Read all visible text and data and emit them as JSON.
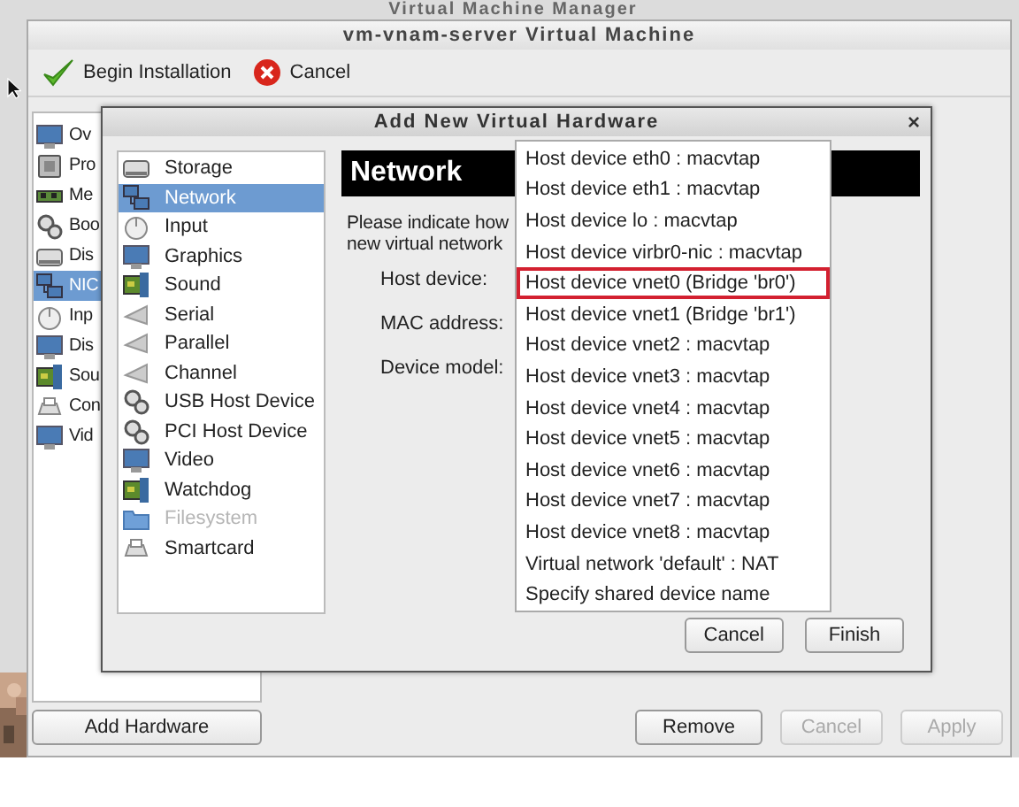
{
  "background_window": {
    "title": "Virtual Machine Manager"
  },
  "window": {
    "title": "vm-vnam-server Virtual Machine"
  },
  "toolbar": [
    {
      "label": "Begin Installation"
    },
    {
      "label": "Cancel"
    }
  ],
  "hardware_list": [
    {
      "label": "Ov",
      "selected": false
    },
    {
      "label": "Pro",
      "selected": false
    },
    {
      "label": "Me",
      "selected": false
    },
    {
      "label": "Boo",
      "selected": false
    },
    {
      "label": "Dis",
      "selected": false
    },
    {
      "label": "NIC",
      "selected": true
    },
    {
      "label": "Inp",
      "selected": false
    },
    {
      "label": "Dis",
      "selected": false
    },
    {
      "label": "Sou",
      "selected": false
    },
    {
      "label": "Con",
      "selected": false
    },
    {
      "label": "Vid",
      "selected": false
    }
  ],
  "add_hardware_button": "Add Hardware",
  "footer_buttons": [
    {
      "label": "Remove",
      "disabled": false
    },
    {
      "label": "Cancel",
      "disabled": true
    },
    {
      "label": "Apply",
      "disabled": true
    }
  ],
  "dialog": {
    "title": "Add New Virtual Hardware",
    "close": "×",
    "categories": [
      {
        "label": "Storage",
        "selected": false,
        "disabled": false
      },
      {
        "label": "Network",
        "selected": true,
        "disabled": false
      },
      {
        "label": "Input",
        "selected": false,
        "disabled": false
      },
      {
        "label": "Graphics",
        "selected": false,
        "disabled": false
      },
      {
        "label": "Sound",
        "selected": false,
        "disabled": false
      },
      {
        "label": "Serial",
        "selected": false,
        "disabled": false
      },
      {
        "label": "Parallel",
        "selected": false,
        "disabled": false
      },
      {
        "label": "Channel",
        "selected": false,
        "disabled": false
      },
      {
        "label": "USB Host Device",
        "selected": false,
        "disabled": false
      },
      {
        "label": "PCI Host Device",
        "selected": false,
        "disabled": false
      },
      {
        "label": "Video",
        "selected": false,
        "disabled": false
      },
      {
        "label": "Watchdog",
        "selected": false,
        "disabled": false
      },
      {
        "label": "Filesystem",
        "selected": false,
        "disabled": true
      },
      {
        "label": "Smartcard",
        "selected": false,
        "disabled": false
      }
    ],
    "header": "Network",
    "description": [
      "Please indicate how",
      "new virtual network"
    ],
    "fields": [
      {
        "label": "Host device:"
      },
      {
        "label": "MAC address:"
      },
      {
        "label": "Device model:"
      }
    ],
    "buttons": [
      "Cancel",
      "Finish"
    ]
  },
  "host_device_dropdown": {
    "options": [
      {
        "label": "Host device eth0 : macvtap",
        "highlighted": false
      },
      {
        "label": "Host device eth1 : macvtap",
        "highlighted": false
      },
      {
        "label": "Host device lo : macvtap",
        "highlighted": false
      },
      {
        "label": "Host device virbr0-nic : macvtap",
        "highlighted": false
      },
      {
        "label": "Host device vnet0 (Bridge 'br0')",
        "highlighted": true
      },
      {
        "label": "Host device vnet1 (Bridge 'br1')",
        "highlighted": false
      },
      {
        "label": "Host device vnet2 : macvtap",
        "highlighted": false
      },
      {
        "label": "Host device vnet3 : macvtap",
        "highlighted": false
      },
      {
        "label": "Host device vnet4 : macvtap",
        "highlighted": false
      },
      {
        "label": "Host device vnet5 : macvtap",
        "highlighted": false
      },
      {
        "label": "Host device vnet6 : macvtap",
        "highlighted": false
      },
      {
        "label": "Host device vnet7 : macvtap",
        "highlighted": false
      },
      {
        "label": "Host device vnet8 : macvtap",
        "highlighted": false
      },
      {
        "label": "Virtual network 'default' : NAT",
        "highlighted": false
      },
      {
        "label": "Specify shared device name",
        "highlighted": false
      }
    ]
  }
}
